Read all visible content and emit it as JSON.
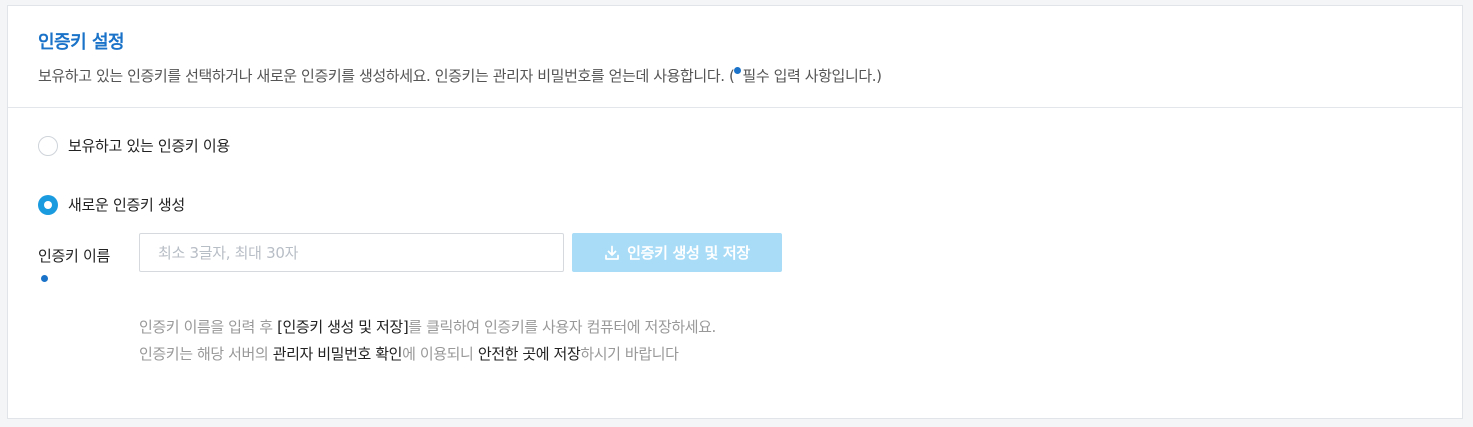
{
  "section": {
    "title": "인증키 설정",
    "description": "보유하고 있는 인증키를 선택하거나 새로운 인증키를 생성하세요. 인증키는 관리자 비밀번호를 얻는데 사용합니다. (",
    "description_required": "필수 입력 사항입니다.)"
  },
  "options": {
    "existing": {
      "label": "보유하고 있는 인증키 이용",
      "selected": false
    },
    "new": {
      "label": "새로운 인증키 생성",
      "selected": true
    }
  },
  "key_name": {
    "label": "인증키 이름",
    "value": "",
    "placeholder": "최소 3글자, 최대 30자"
  },
  "generate_button": {
    "label": "인증키 생성 및 저장",
    "icon": "download-icon",
    "enabled": false
  },
  "help": {
    "line1_a": "인증키 이름을 입력 후 ",
    "line1_b": "[인증키 생성 및 저장]",
    "line1_c": "를 클릭하여 인증키를 사용자 컴퓨터에 저장하세요.",
    "line2_a": "인증키는 해당 서버의 ",
    "line2_b": "관리자 비밀번호 확인",
    "line2_c": "에 이용되니 ",
    "line2_d": "안전한 곳에 저장",
    "line2_e": "하시기 바랍니다"
  },
  "colors": {
    "accent": "#1a73c8",
    "radio_selected": "#1a9be0",
    "button_disabled": "#a9dcf7"
  }
}
